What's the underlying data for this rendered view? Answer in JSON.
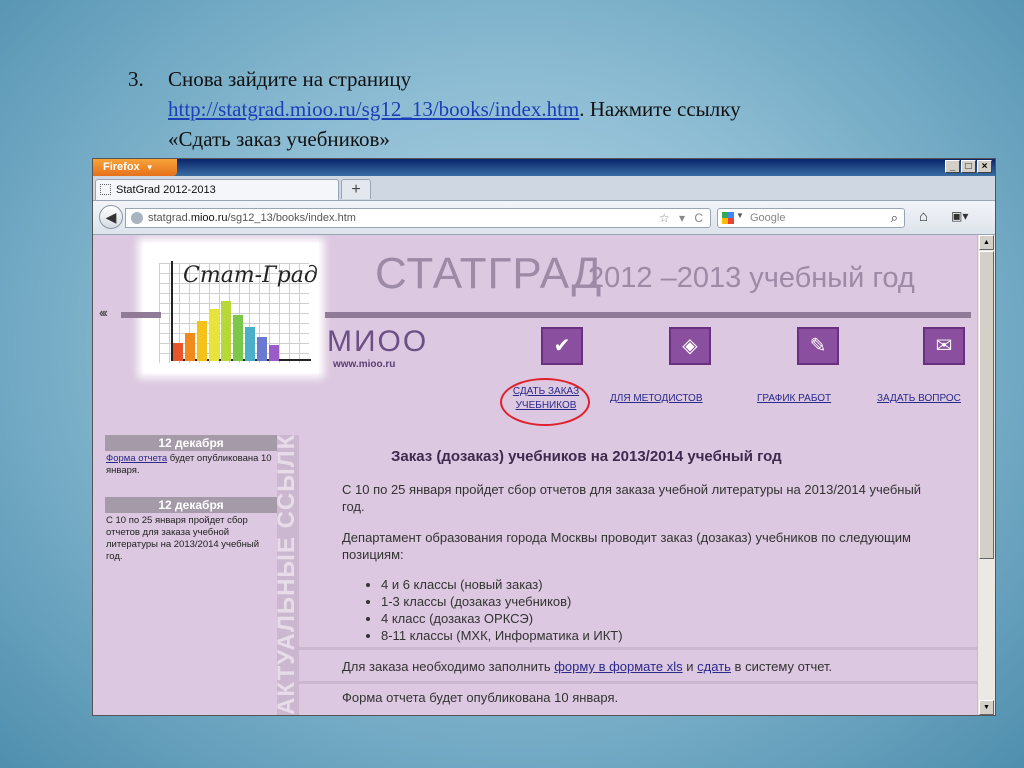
{
  "slide": {
    "step_number": "3.",
    "line1": "Снова зайдите на страницу",
    "url": "http://statgrad.mioo.ru/sg12_13/books/index.htm",
    "after_url": ".  Нажмите ссылку",
    "line3": "«Сдать заказ учебников»"
  },
  "browser": {
    "app_button": "Firefox",
    "window_controls": [
      "_",
      "□",
      "×"
    ],
    "tab_title": "StatGrad 2012-2013",
    "new_tab": "+",
    "url_prefix": "statgrad.",
    "url_host": "mioo.ru",
    "url_path": "/sg12_13/books/index.htm",
    "url_actions": "☆ ▾ C",
    "search_placeholder": "Google"
  },
  "site": {
    "logo_text": "Стат-Град",
    "title": "СТАТГРАД",
    "years": "2012 –2013 учебный год",
    "arrows": "‹‹‹",
    "brand": "МИОО",
    "brand_url": "www.mioo.ru",
    "nav": {
      "order_line1": "СДАТЬ ЗАКАЗ",
      "order_line2": "УЧЕБНИКОВ",
      "methodists": "ДЛЯ МЕТОДИСТОВ",
      "schedule": "ГРАФИК РАБОТ",
      "ask": "ЗАДАТЬ ВОПРОС"
    },
    "side": {
      "news1_date": "12 декабря",
      "news1_link": "Форма отчета",
      "news1_text": " будет опубликована 10 января.",
      "news2_date": "12 декабря",
      "news2_text": "С 10 по 25 января пройдет сбор отчетов для заказа учебной литературы на 2013/2014 учебный год.",
      "banner": "АКТУАЛЬНЫЕ ССЫЛКИ"
    },
    "main": {
      "heading": "Заказ (дозаказ) учебников на 2013/2014 учебный год",
      "para1": "С 10 по 25 января пройдет сбор отчетов для заказа учебной литературы на 2013/2014 учебный год.",
      "para2": "Департамент образования города Москвы проводит заказ (дозаказ) учебников по следующим позициям:",
      "bullets": [
        "4 и 6 классы (новый заказ)",
        "1-3 классы (дозаказ учебников)",
        "4 класс (дозаказ ОРКСЭ)",
        "8-11 классы (МХК, Информатика и ИКТ)"
      ],
      "para3_a": "Для заказа необходимо заполнить ",
      "para3_link1": "форму в формате xls",
      "para3_b": " и ",
      "para3_link2": "сдать",
      "para3_c": " в систему отчет.",
      "para4": "Форма отчета будет опубликована 10 января."
    }
  },
  "colors": {
    "page_bg": "#dcc8e0",
    "accent": "#8a4f9e",
    "highlight_circle": "#e0202a"
  }
}
